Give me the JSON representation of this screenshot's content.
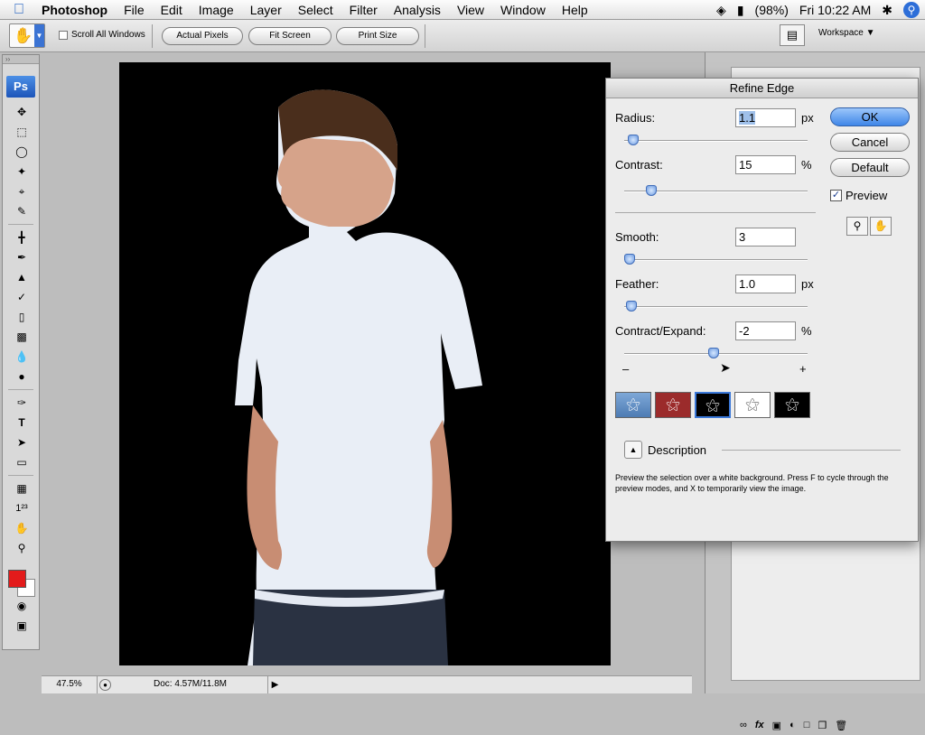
{
  "menubar": {
    "app": "Photoshop",
    "items": [
      "File",
      "Edit",
      "Image",
      "Layer",
      "Select",
      "Filter",
      "Analysis",
      "View",
      "Window",
      "Help"
    ],
    "battery": "(98%)",
    "clock": "Fri 10:22 AM"
  },
  "options": {
    "scroll_all": "Scroll All Windows",
    "actual_pixels": "Actual Pixels",
    "fit_screen": "Fit Screen",
    "print_size": "Print Size",
    "workspace": "Workspace"
  },
  "toolbox": {
    "logo": "Ps",
    "tools": [
      "move",
      "marquee",
      "lasso",
      "magic-wand",
      "crop",
      "eyedropper",
      "healing",
      "brush",
      "clone-stamp",
      "history-brush",
      "eraser",
      "gradient",
      "blur",
      "dodge",
      "pen",
      "type",
      "path-selection",
      "shape",
      "notes",
      "count",
      "hand",
      "zoom"
    ],
    "colors": {
      "foreground": "#e31b1b",
      "background": "#ffffff"
    }
  },
  "status": {
    "zoom": "47.5%",
    "doc": "Doc: 4.57M/11.8M"
  },
  "dialog": {
    "title": "Refine Edge",
    "radius_label": "Radius:",
    "radius_value": "1.1",
    "radius_unit": "px",
    "radius_level": 0.05,
    "contrast_label": "Contrast:",
    "contrast_value": "15",
    "contrast_unit": "%",
    "contrast_level": 0.15,
    "smooth_label": "Smooth:",
    "smooth_value": "3",
    "smooth_level": 0.03,
    "feather_label": "Feather:",
    "feather_value": "1.0",
    "feather_unit": "px",
    "feather_level": 0.04,
    "contract_label": "Contract/Expand:",
    "contract_value": "-2",
    "contract_unit": "%",
    "contract_level": 0.49,
    "minus": "–",
    "plus": "+",
    "ok": "OK",
    "cancel": "Cancel",
    "default": "Default",
    "preview": "Preview",
    "preview_checked": true,
    "description_title": "Description",
    "description": "Preview the selection over a white background. Press F to cycle through the preview modes, and X to temporarily view the image."
  }
}
